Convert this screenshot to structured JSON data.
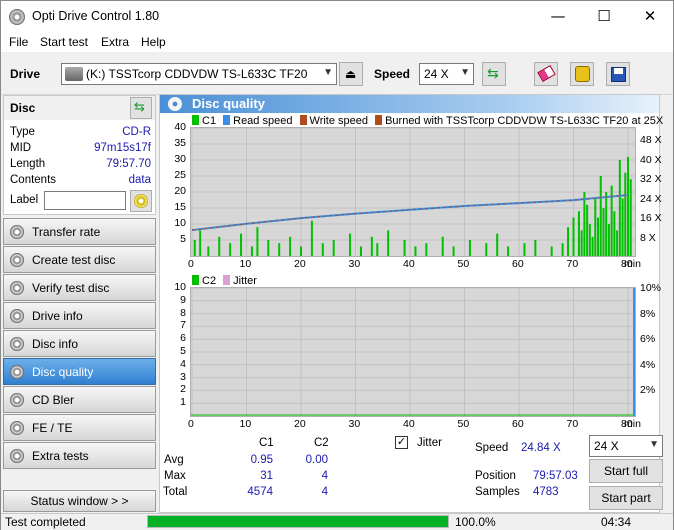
{
  "window": {
    "title": "Opti Drive Control 1.80"
  },
  "menu": [
    "File",
    "Start test",
    "Extra",
    "Help"
  ],
  "toolbar": {
    "drive_label": "Drive",
    "drive_value": "(K:)  TSSTcorp CDDVDW TS-L633C TF20",
    "speed_label": "Speed",
    "speed_value": "24 X"
  },
  "disc": {
    "header": "Disc",
    "rows": [
      {
        "key": "Type",
        "value": "CD-R"
      },
      {
        "key": "MID",
        "value": "97m15s17f"
      },
      {
        "key": "Length",
        "value": "79:57.70"
      },
      {
        "key": "Contents",
        "value": "data"
      }
    ],
    "label_key": "Label",
    "label_value": ""
  },
  "nav": [
    {
      "label": "Transfer rate"
    },
    {
      "label": "Create test disc"
    },
    {
      "label": "Verify test disc"
    },
    {
      "label": "Drive info"
    },
    {
      "label": "Disc info"
    },
    {
      "label": "Disc quality"
    },
    {
      "label": "CD Bler"
    },
    {
      "label": "FE / TE"
    },
    {
      "label": "Extra tests"
    }
  ],
  "nav_active_index": 5,
  "status_window_btn": "Status window > >",
  "panel": {
    "title": "Disc quality"
  },
  "chart_data": [
    {
      "type": "bar",
      "legend": [
        "C1",
        "Read speed",
        "Write speed",
        "Burned with TSSTcorp CDDVDW TS-L633C TF20 at 25X"
      ],
      "colors": {
        "C1": "#00c000",
        "Read speed": "#3a8ee6",
        "Write speed": "#b04b1c"
      },
      "ylim": [
        0,
        40
      ],
      "yticks": [
        "40",
        "35",
        "30",
        "25",
        "20",
        "15",
        "10",
        "5"
      ],
      "y2ticks": [
        "48 X",
        "40 X",
        "32 X",
        "24 X",
        "16 X",
        "8 X"
      ],
      "xlim": [
        0,
        80
      ],
      "xticks": [
        "0",
        "10",
        "20",
        "30",
        "40",
        "50",
        "60",
        "70",
        "80"
      ],
      "xunit": "min",
      "bars_x": [
        0.5,
        1.5,
        3,
        5,
        7,
        9,
        11,
        12,
        14,
        16,
        18,
        20,
        22,
        24,
        26,
        29,
        31,
        33,
        34,
        36,
        39,
        41,
        43,
        46,
        48,
        51,
        54,
        56,
        58,
        61,
        63,
        66,
        68,
        69,
        70,
        71,
        71.5,
        72,
        72.5,
        73,
        73.5,
        74,
        74.5,
        75,
        75.5,
        76,
        76.5,
        77,
        77.5,
        78,
        78.5,
        79,
        79.5,
        80,
        80.5
      ],
      "bars_y": [
        5,
        8,
        3,
        6,
        4,
        7,
        3,
        9,
        5,
        4,
        6,
        3,
        11,
        4,
        5,
        7,
        3,
        6,
        4,
        8,
        5,
        3,
        4,
        6,
        3,
        5,
        4,
        7,
        3,
        4,
        5,
        3,
        4,
        9,
        12,
        14,
        8,
        20,
        16,
        10,
        6,
        18,
        12,
        25,
        15,
        20,
        10,
        22,
        14,
        8,
        30,
        18,
        26,
        31,
        24
      ],
      "read_speed_x": [
        0,
        10,
        20,
        30,
        40,
        50,
        60,
        70,
        80
      ],
      "read_speed_y": [
        10.5,
        13.1,
        15.4,
        17.2,
        18.8,
        20.3,
        21.5,
        22.7,
        24.8
      ]
    },
    {
      "type": "line",
      "legend": [
        "C2",
        "Jitter"
      ],
      "colors": {
        "C2": "#00c000",
        "Jitter": "#d8a0d8"
      },
      "ylim": [
        0,
        10
      ],
      "yticks": [
        "10",
        "9",
        "8",
        "7",
        "6",
        "5",
        "4",
        "3",
        "2",
        "1"
      ],
      "y2ticks": [
        "10%",
        "8%",
        "6%",
        "4%",
        "2%"
      ],
      "xlim": [
        0,
        80
      ],
      "xticks": [
        "0",
        "10",
        "20",
        "30",
        "40",
        "50",
        "60",
        "70",
        "80"
      ],
      "xunit": "min"
    }
  ],
  "stats": {
    "col_c1": "C1",
    "col_c2": "C2",
    "rows": [
      {
        "label": "Avg",
        "c1": "0.95",
        "c2": "0.00"
      },
      {
        "label": "Max",
        "c1": "31",
        "c2": "4"
      },
      {
        "label": "Total",
        "c1": "4574",
        "c2": "4"
      }
    ],
    "jitter_label": "Jitter",
    "jitter_checked": true,
    "speed_label": "Speed",
    "speed_value": "24.84 X",
    "speed_select": "24 X",
    "position_label": "Position",
    "position_value": "79:57.03",
    "samples_label": "Samples",
    "samples_value": "4783",
    "start_full": "Start full",
    "start_part": "Start part"
  },
  "status": {
    "text": "Test completed",
    "progress_pct": 100,
    "progress_text": "100.0%",
    "elapsed": "04:34"
  }
}
